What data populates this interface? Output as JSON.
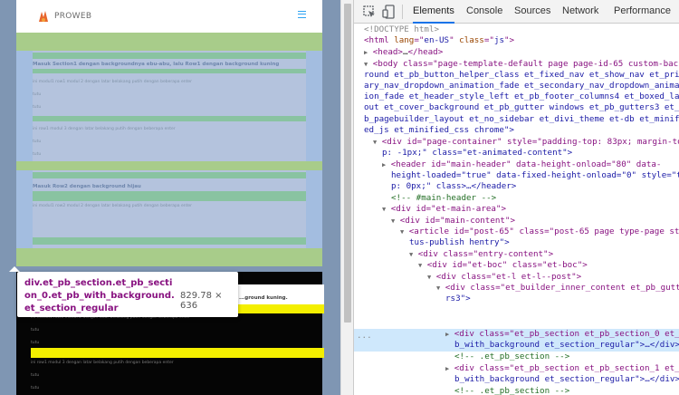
{
  "site": {
    "logo_text": "PROWEB",
    "section0": {
      "heading": "Masuk Section1 dengan backgroundnya ebu-abu, lalu Row1 dengan background kuning",
      "modul1": "ini modul1 row1 modul 2 dengan latar belakang putih dengan beberapa enter",
      "label_a": "tutu",
      "label_b": "tutu",
      "modul3": "ini row1 modul 3 dengan latar belakang putih dengan beberapa enter",
      "label_c": "tutu",
      "label_d": "tutu",
      "row2_heading": "Masuk Row2 dengan background hijau",
      "row2_text": "ini modul1 row2 modul 2 dengan latar belakang putih dengan beberapa enter"
    },
    "section1": {
      "heading": "...ground kuning.",
      "modul1": "ini modul1 row1 modul 2 dengan latar belakang putih dengan beberapa enter",
      "label_a": "tutu",
      "label_b": "tutu",
      "modul3": "ini row1 modul 3 dengan latar belakang putih dengan beberapa enter",
      "label_c": "tutu",
      "label_d": "tutu"
    }
  },
  "tooltip": {
    "selector": "div.et_pb_section.et_pb_section_0.et_pb_with_background.et_section_regular",
    "size": "829.78 × 636"
  },
  "devtools": {
    "tabs": [
      "Elements",
      "Console",
      "Sources",
      "Network",
      "Performance"
    ],
    "active_tab": "Elements",
    "lines": {
      "doctype": "<!DOCTYPE html>",
      "html_open": [
        "<html",
        " lang",
        "=\"",
        "en-US",
        "\"",
        " class",
        "=\"",
        "js",
        "\">"
      ],
      "head": [
        "<head>",
        "…",
        "</head>"
      ],
      "body_a": "<body class=\"page-template-default page page-id-65 custom-backg",
      "body_b": "round et_pb_button_helper_class et_fixed_nav et_show_nav et_prim",
      "body_c": "ary_nav_dropdown_animation_fade et_secondary_nav_dropdown_animat",
      "body_d": "ion_fade et_header_style_left et_pb_footer_columns4 et_boxed_lay",
      "body_e": "out et_cover_background et_pb_gutter windows et_pb_gutters3 et_p",
      "body_f": "b_pagebuilder_layout et_no_sidebar et_divi_theme et-db et_minifi",
      "body_g": "ed_js et_minified_css chrome\">",
      "pagecont_a": "<div id=\"page-container\" style=\"padding-top: 83px; margin-to",
      "pagecont_b": "p: -1px;\" class=\"et-animated-content\">",
      "header_a": "<header id=\"main-header\" data-height-onload=\"80\" data-",
      "header_b": "height-loaded=\"true\" data-fixed-height-onload=\"0\" style=\"to",
      "header_c": "p: 0px;\" class>…</header>",
      "comment_header": "<!-- #main-header -->",
      "mainarea": "<div id=\"et-main-area\">",
      "maincontent": "<div id=\"main-content\">",
      "article_a": "<article id=\"post-65\" class=\"post-65 page type-page sta",
      "article_b": "tus-publish hentry\">",
      "entry": "<div class=\"entry-content\">",
      "etboc": "<div id=\"et-boc\" class=\"et-boc\">",
      "etl": "<div class=\"et-l et-l--post\">",
      "inner_a": "<div class=\"et_builder_inner_content et_pb_gutte",
      "inner_b": "rs3\">",
      "sec0_a": "<div class=\"et_pb_section et_pb_section_0 et_p",
      "sec0_b": "b_with_background et_section_regular\">…</div> ==",
      "comment_sec": "<!-- .et_pb_section -->",
      "sec1_a": "<div class=\"et_pb_section et_pb_section_1 et_p",
      "sec1_b": "b_with_background et_section_regular\">…</div>",
      "comment_sec2": "<!-- .et_pb_section -->",
      "ellipsis": "..."
    }
  },
  "colors": {
    "section0_bg": "#c4d8a3",
    "row_blue": "#b4c3dd",
    "teal": "#89c3a1",
    "yellow": "#f4ef00",
    "selected_row": "#cfe8fc",
    "tag": "#881280",
    "attr_name": "#994500",
    "attr_value": "#1a1aa6",
    "comment": "#236e25"
  },
  "icons": [
    "inspect-element-icon",
    "device-toolbar-icon",
    "hamburger-menu-icon",
    "proweb-logo-icon"
  ]
}
